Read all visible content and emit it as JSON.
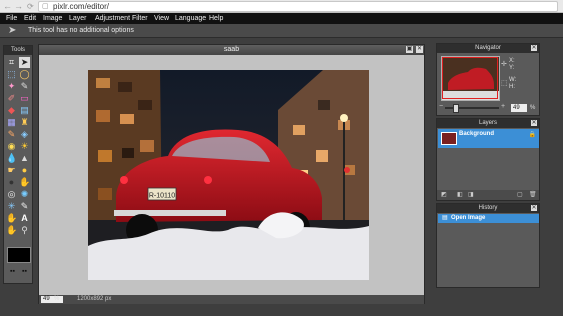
{
  "browser": {
    "back": "←",
    "forward": "→",
    "reload": "C",
    "url": "pixlr.com/editor/"
  },
  "menu": [
    "File",
    "Edit",
    "Image",
    "Layer",
    "Adjustment",
    "Filter",
    "View",
    "Language",
    "Help"
  ],
  "options_bar": {
    "text": "This tool has no additional options"
  },
  "tools_panel": {
    "title": "Tools"
  },
  "document": {
    "title": "saab",
    "zoom": "49",
    "zoom_unit": "%",
    "size": "1200x892 px",
    "plate": "R-10110"
  },
  "navigator": {
    "title": "Navigator",
    "x_label": "X:",
    "y_label": "Y:",
    "w_label": "W:",
    "h_label": "H:",
    "zoom": "49",
    "zoom_unit": "%"
  },
  "layers": {
    "title": "Layers",
    "items": [
      {
        "name": "Background"
      }
    ]
  },
  "history": {
    "title": "History",
    "items": [
      {
        "name": "Open Image"
      }
    ]
  },
  "colors": {
    "accent": "#3c8fd6",
    "menu_bg": "#111111",
    "workspace": "#3e3e3e"
  }
}
